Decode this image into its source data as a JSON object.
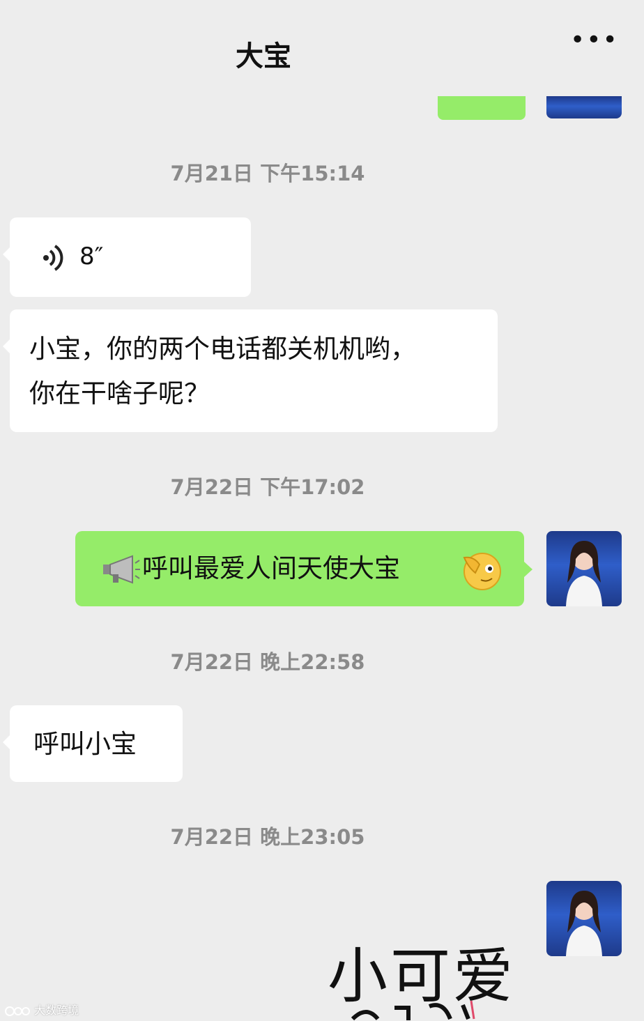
{
  "header": {
    "title": "大宝",
    "more_icon": "more-dots-icon"
  },
  "messages": [
    {
      "type": "timestamp",
      "text": "7月21日 下午15:14"
    },
    {
      "type": "voice",
      "side": "left",
      "duration": "8″",
      "icon": "voice-wave-icon"
    },
    {
      "type": "text",
      "side": "left",
      "lines": [
        "小宝，你的两个电话都关机机哟，",
        "你在干啥子呢？"
      ]
    },
    {
      "type": "timestamp",
      "text": "7月22日 下午17:02"
    },
    {
      "type": "text",
      "side": "right",
      "text": "呼叫最爱人间天使大宝",
      "leading_icon": "megaphone-icon",
      "trailing_icon": "salute-emoji-icon"
    },
    {
      "type": "timestamp",
      "text": "7月22日 晚上22:58"
    },
    {
      "type": "text",
      "side": "left",
      "text": "呼叫小宝"
    },
    {
      "type": "timestamp",
      "text": "7月22日 晚上23:05"
    },
    {
      "type": "sticker",
      "side": "right",
      "text": "小可爱"
    }
  ],
  "watermark": "大数跨境",
  "colors": {
    "background": "#ededed",
    "self_bubble": "#95ec69",
    "other_bubble": "#ffffff",
    "timestamp": "#8a8a8a"
  }
}
